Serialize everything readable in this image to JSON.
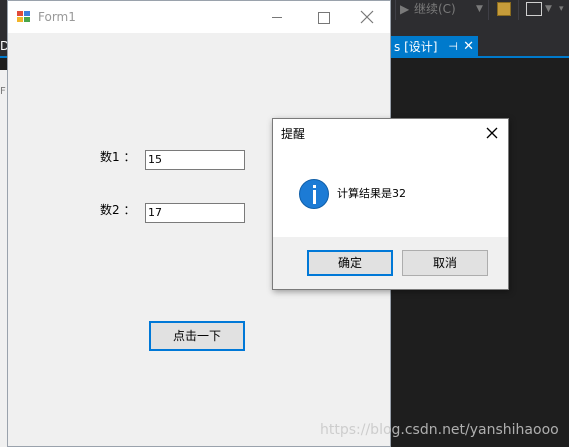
{
  "ide": {
    "toolbar_continue_label": "继续(C)",
    "tab_label": "s [设计]",
    "tab_pin": "ᛞ",
    "left_letter": "D",
    "left_panel_letter": "F"
  },
  "form1": {
    "title": "Form1",
    "label1": "数1 ：",
    "input1_value": "15",
    "label2": "数2 ：",
    "input2_value": "17",
    "button_label": "点击一下"
  },
  "msgbox": {
    "title": "提醒",
    "message": "计算结果是32",
    "ok_label": "确定",
    "cancel_label": "取消"
  },
  "watermark": "https://blog.csdn.net/yanshihaooo",
  "colors": {
    "accent": "#007acc",
    "focus": "#0078d7",
    "info_icon": "#1c7bd5"
  }
}
